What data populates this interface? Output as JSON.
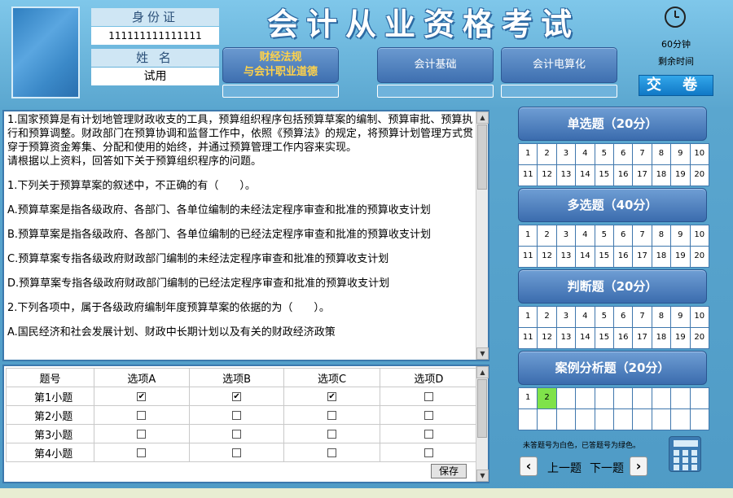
{
  "header": {
    "title": "会计从业资格考试",
    "id_label": "身份证",
    "id_value": "111111111111111",
    "name_label": "姓 名",
    "name_value": "试用",
    "subjects": [
      {
        "line1": "财经法规",
        "line2": "与会计职业道德",
        "active": true
      },
      {
        "line1": "会计基础",
        "line2": "",
        "active": false
      },
      {
        "line1": "会计电算化",
        "line2": "",
        "active": false
      }
    ],
    "time_value": "60分钟",
    "time_label": "剩余时间",
    "submit_label": "交 卷"
  },
  "question": {
    "paragraphs": [
      "1.国家预算是有计划地管理财政收支的工具，预算组织程序包括预算草案的编制、预算审批、预算执行和预算调整。财政部门在预算协调和监督工作中，依照《预算法》的规定，将预算计划管理方式贯穿于预算资金筹集、分配和使用的始终，并通过预算管理工作内容来实现。",
      "请根据以上资料，回答如下关于预算组织程序的问题。"
    ],
    "items": [
      "1.下列关于预算草案的叙述中，不正确的有（　　）。",
      "A.预算草案是指各级政府、各部门、各单位编制的未经法定程序审查和批准的预算收支计划",
      "B.预算草案是指各级政府、各部门、各单位编制的已经法定程序审查和批准的预算收支计划",
      "C.预算草案专指各级政府财政部门编制的未经法定程序审查和批准的预算收支计划",
      "D.预算草案专指各级政府财政部门编制的已经法定程序审查和批准的预算收支计划",
      "2.下列各项中，属于各级政府编制年度预算草案的依据的为（　　）。",
      "A.国民经济和社会发展计划、财政中长期计划以及有关的财政经济政策"
    ]
  },
  "answers": {
    "headers": [
      "题号",
      "选项A",
      "选项B",
      "选项C",
      "选项D"
    ],
    "rows": [
      {
        "label": "第1小题",
        "checked": [
          true,
          true,
          true,
          false
        ]
      },
      {
        "label": "第2小题",
        "checked": [
          false,
          false,
          false,
          false
        ]
      },
      {
        "label": "第3小题",
        "checked": [
          false,
          false,
          false,
          false
        ]
      },
      {
        "label": "第4小题",
        "checked": [
          false,
          false,
          false,
          false
        ]
      }
    ],
    "save_label": "保存"
  },
  "sections": [
    {
      "label": "单选题（20分）",
      "numbers": [
        "1",
        "2",
        "3",
        "4",
        "5",
        "6",
        "7",
        "8",
        "9",
        "10",
        "11",
        "12",
        "13",
        "14",
        "15",
        "16",
        "17",
        "18",
        "19",
        "20"
      ],
      "answered": []
    },
    {
      "label": "多选题（40分）",
      "numbers": [
        "1",
        "2",
        "3",
        "4",
        "5",
        "6",
        "7",
        "8",
        "9",
        "10",
        "11",
        "12",
        "13",
        "14",
        "15",
        "16",
        "17",
        "18",
        "19",
        "20"
      ],
      "answered": []
    },
    {
      "label": "判断题（20分）",
      "numbers": [
        "1",
        "2",
        "3",
        "4",
        "5",
        "6",
        "7",
        "8",
        "9",
        "10",
        "11",
        "12",
        "13",
        "14",
        "15",
        "16",
        "17",
        "18",
        "19",
        "20"
      ],
      "answered": []
    },
    {
      "label": "案例分析题（20分）",
      "numbers": [
        "1",
        "2",
        "",
        "",
        "",
        "",
        "",
        "",
        "",
        "",
        "",
        "",
        "",
        "",
        "",
        "",
        "",
        "",
        "",
        ""
      ],
      "answered": [
        "2"
      ]
    }
  ],
  "legend": "未答题号为白色，已答题号为绿色。",
  "nav": {
    "prev_label": "上一题",
    "next_label": "下一题"
  },
  "colors": {
    "answered": "#7fe24a",
    "accent": "#3b6cae",
    "active_subject": "#ffd24a"
  }
}
